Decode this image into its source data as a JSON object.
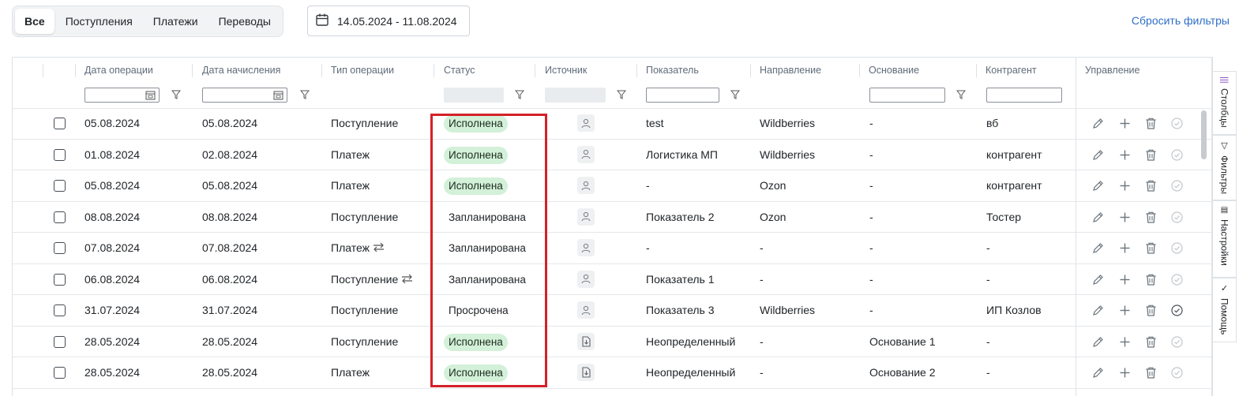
{
  "tabs": [
    {
      "label": "Все",
      "active": true
    },
    {
      "label": "Поступления",
      "active": false
    },
    {
      "label": "Платежи",
      "active": false
    },
    {
      "label": "Переводы",
      "active": false
    }
  ],
  "date_range": "14.05.2024 - 11.08.2024",
  "reset_filters": "Сбросить фильтры",
  "columns": {
    "op_date": "Дата операции",
    "accrual_date": "Дата начисления",
    "op_type": "Тип операции",
    "status": "Статус",
    "source": "Источник",
    "indicator": "Показатель",
    "direction": "Направление",
    "basis": "Основание",
    "counterparty": "Контрагент",
    "management": "Управление"
  },
  "side_tabs": [
    "Столбцы",
    "Фильтры",
    "Настройки",
    "Помощь"
  ],
  "status_colors": {
    "done": "#d3f0d8",
    "planned": "#b9def5",
    "overdue": "#f9cfd0"
  },
  "rows": [
    {
      "op_date": "05.08.2024",
      "accrual_date": "05.08.2024",
      "op_type": "Поступление",
      "transfer": false,
      "status": "Исполнена",
      "status_kind": "done",
      "source": "user",
      "indicator": "test",
      "direction": "Wildberries",
      "basis": "-",
      "counterparty": "вб",
      "confirmed": false
    },
    {
      "op_date": "01.08.2024",
      "accrual_date": "02.08.2024",
      "op_type": "Платеж",
      "transfer": false,
      "status": "Исполнена",
      "status_kind": "done",
      "source": "user",
      "indicator": "Логистика МП",
      "direction": "Wildberries",
      "basis": "-",
      "counterparty": "контрагент",
      "confirmed": false
    },
    {
      "op_date": "05.08.2024",
      "accrual_date": "05.08.2024",
      "op_type": "Платеж",
      "transfer": false,
      "status": "Исполнена",
      "status_kind": "done",
      "source": "user",
      "indicator": "-",
      "direction": "Ozon",
      "basis": "-",
      "counterparty": "контрагент",
      "confirmed": false
    },
    {
      "op_date": "08.08.2024",
      "accrual_date": "08.08.2024",
      "op_type": "Поступление",
      "transfer": false,
      "status": "Запланирована",
      "status_kind": "planned",
      "source": "user",
      "indicator": "Показатель 2",
      "direction": "Ozon",
      "basis": "-",
      "counterparty": "Тостер",
      "confirmed": false
    },
    {
      "op_date": "07.08.2024",
      "accrual_date": "07.08.2024",
      "op_type": "Платеж",
      "transfer": true,
      "status": "Запланирована",
      "status_kind": "planned",
      "source": "user",
      "indicator": "-",
      "direction": "-",
      "basis": "-",
      "counterparty": "-",
      "confirmed": false
    },
    {
      "op_date": "06.08.2024",
      "accrual_date": "06.08.2024",
      "op_type": "Поступление",
      "transfer": true,
      "status": "Запланирована",
      "status_kind": "planned",
      "source": "user",
      "indicator": "Показатель 1",
      "direction": "-",
      "basis": "-",
      "counterparty": "-",
      "confirmed": false
    },
    {
      "op_date": "31.07.2024",
      "accrual_date": "31.07.2024",
      "op_type": "Поступление",
      "transfer": false,
      "status": "Просрочена",
      "status_kind": "overdue",
      "source": "user",
      "indicator": "Показатель 3",
      "direction": "Wildberries",
      "basis": "-",
      "counterparty": "ИП Козлов",
      "confirmed": true
    },
    {
      "op_date": "28.05.2024",
      "accrual_date": "28.05.2024",
      "op_type": "Поступление",
      "transfer": false,
      "status": "Исполнена",
      "status_kind": "done",
      "source": "import",
      "indicator": "Неопределенный",
      "direction": "-",
      "basis": "Основание 1",
      "counterparty": "-",
      "confirmed": false
    },
    {
      "op_date": "28.05.2024",
      "accrual_date": "28.05.2024",
      "op_type": "Платеж",
      "transfer": false,
      "status": "Исполнена",
      "status_kind": "done",
      "source": "import",
      "indicator": "Неопределенный",
      "direction": "-",
      "basis": "Основание 2",
      "counterparty": "-",
      "confirmed": false
    }
  ]
}
